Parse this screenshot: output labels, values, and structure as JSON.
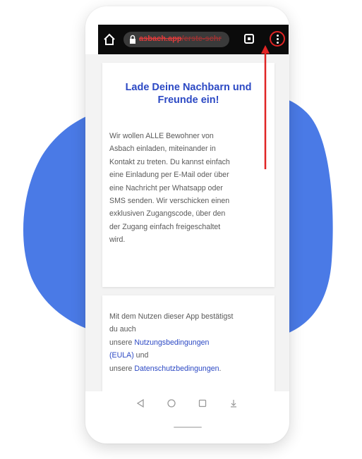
{
  "browser": {
    "url_domain": "asbach.app",
    "url_path": "/erste-schr"
  },
  "invite_card": {
    "title_line1": "Lade Deine Nachbarn und",
    "title_line2": "Freunde ein!",
    "body_lines": [
      "Wir wollen ALLE Bewohner von",
      "Asbach einladen, miteinander in",
      "Kontakt zu treten. Du kannst einfach",
      "eine Einladung per E-Mail oder über",
      "eine Nachricht per Whatsapp oder",
      "SMS senden. Wir verschicken einen",
      "exklusiven Zugangscode, über den",
      "der Zugang einfach freigeschaltet",
      "wird."
    ]
  },
  "terms_card": {
    "line1": "Mit dem Nutzen dieser App bestätigst",
    "line2": "du auch",
    "prefix_eula": "unsere ",
    "eula_link_1": "Nutzungsbedingungen",
    "eula_link_2": "(EULA)",
    "suffix_eula": " und",
    "prefix_privacy": "unsere ",
    "privacy_link": "Datenschutzbedingungen",
    "suffix_privacy": "."
  },
  "icons": {
    "browser_home": "home-icon",
    "lock": "lock-icon",
    "tabs": "tabs-icon",
    "menu": "more-vertical-icon",
    "nav_back": "triangle-back-icon",
    "nav_home": "circle-home-icon",
    "nav_recent": "square-recent-icon",
    "nav_extra": "download-icon"
  },
  "colors": {
    "brand_blue": "#2c49c4",
    "blob_blue": "#4a7ae6",
    "annotation_red": "#e02424",
    "browser_bar": "#0b0b0b"
  }
}
